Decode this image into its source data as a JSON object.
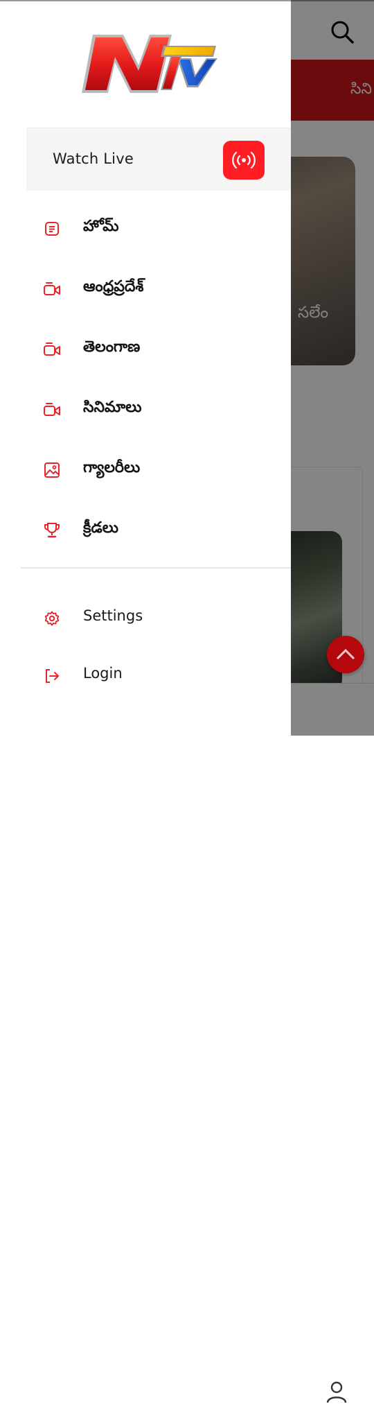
{
  "background": {
    "category_peek": "సిని",
    "card_text": "సలేం",
    "icons": {
      "search": "search-icon",
      "user": "user-icon",
      "scroll_top": "chevron-up-icon"
    }
  },
  "drawer": {
    "logo_text": "NTV",
    "watch_live": {
      "label": "Watch Live",
      "icon": "broadcast-icon"
    },
    "menu": [
      {
        "label": "హోమ్",
        "icon": "article-icon"
      },
      {
        "label": "ఆంధ్రప్రదేశ్",
        "icon": "video-icon"
      },
      {
        "label": "తెలంగాణ",
        "icon": "video-icon"
      },
      {
        "label": "సినిమాలు",
        "icon": "video-icon"
      },
      {
        "label": "గ్యాలరీలు",
        "icon": "image-icon"
      },
      {
        "label": "క్రీడలు",
        "icon": "trophy-icon"
      }
    ],
    "footer": [
      {
        "label": "Settings",
        "icon": "gear-icon"
      },
      {
        "label": "Login",
        "icon": "login-icon"
      }
    ]
  },
  "colors": {
    "accent": "#e8232a",
    "brand_red": "#d0161a",
    "live_button": "#ff1d24"
  }
}
